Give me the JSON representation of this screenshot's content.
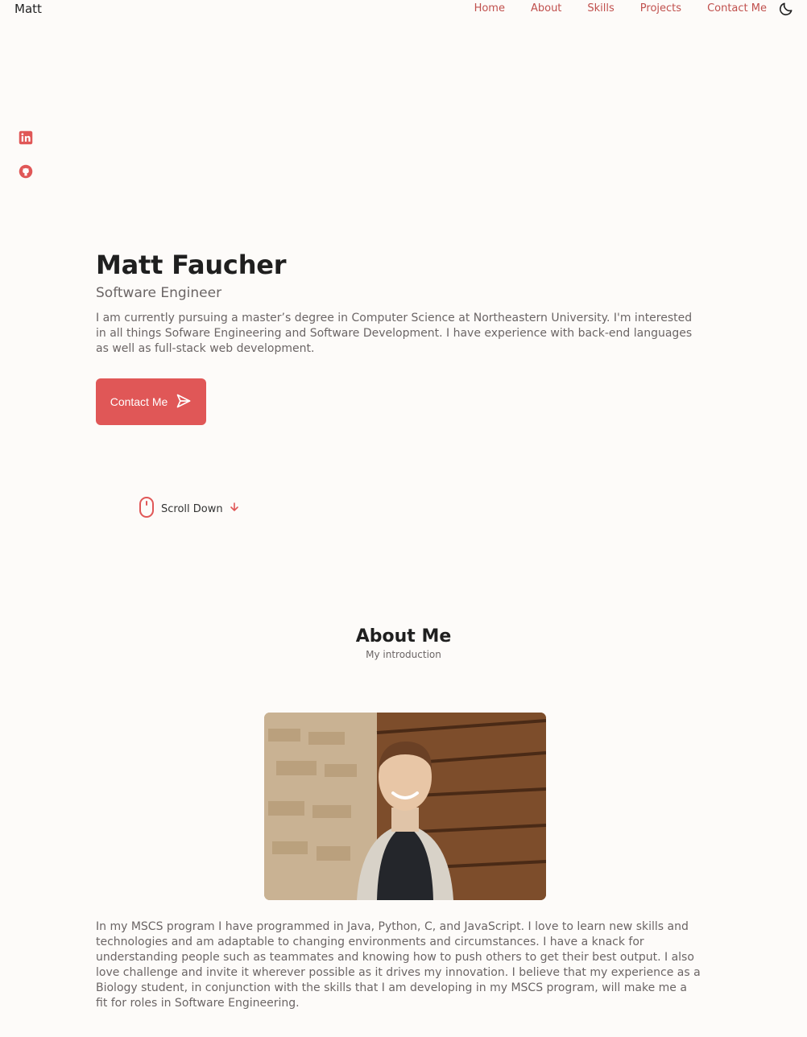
{
  "header": {
    "logo": "Matt",
    "nav": [
      "Home",
      "About",
      "Skills",
      "Projects",
      "Contact Me"
    ]
  },
  "social": [
    "linkedin-icon",
    "github-icon"
  ],
  "hero": {
    "name": "Matt Faucher",
    "title": "Software Engineer",
    "description": "I am currently pursuing a master’s degree in Computer Science at Northeastern University. I'm interested in all things Sofware Engineering and Software Development. I have experience with back-end languages as well as full-stack web development.",
    "button": "Contact Me",
    "scroll": "Scroll Down"
  },
  "about": {
    "title": "About Me",
    "subtitle": "My introduction",
    "text": "In my MSCS program I have programmed in Java, Python, C, and JavaScript. I love to learn new skills and technologies and am adaptable to changing environments and circumstances. I have a knack for understanding people such as teammates and knowing how to push others to get their best output. I also love challenge and invite it wherever possible as it drives my innovation. I believe that my experience as a Biology student, in conjunction with the skills that I am developing in my MSCS program, will make me a fit for roles in Software Engineering."
  },
  "colors": {
    "accent": "#e05757",
    "nav": "#c0504d",
    "background": "#fdfbf9"
  }
}
